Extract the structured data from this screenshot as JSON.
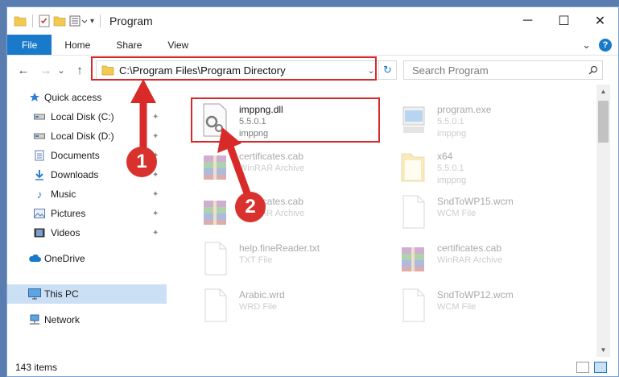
{
  "window": {
    "title": "Program",
    "controls": {
      "minimize": "─",
      "maximize": "☐",
      "close": "✕"
    }
  },
  "ribbon": {
    "tabs": [
      {
        "label": "File"
      },
      {
        "label": "Home"
      },
      {
        "label": "Share"
      },
      {
        "label": "View"
      }
    ],
    "expand_glyph": "⌄",
    "help_glyph": "?"
  },
  "nav": {
    "back_glyph": "←",
    "forward_glyph": "→",
    "recent_glyph": "⌄",
    "up_glyph": "↑",
    "address": "C:\\Program Files\\Program Directory",
    "address_dropdown": "⌄",
    "refresh_glyph": "↻",
    "search_placeholder": "Search Program"
  },
  "sidebar": {
    "items": [
      {
        "label": "Quick access",
        "icon": "star-icon",
        "pinned": false
      },
      {
        "label": "Local Disk (C:)",
        "icon": "drive-icon",
        "pinned": true
      },
      {
        "label": "Local Disk (D:)",
        "icon": "drive-icon",
        "pinned": true
      },
      {
        "label": "Documents",
        "icon": "documents-icon",
        "pinned": true
      },
      {
        "label": "Downloads",
        "icon": "download-icon",
        "pinned": true
      },
      {
        "label": "Music",
        "icon": "music-icon",
        "pinned": true
      },
      {
        "label": "Pictures",
        "icon": "pictures-icon",
        "pinned": true
      },
      {
        "label": "Videos",
        "icon": "videos-icon",
        "pinned": true
      },
      {
        "label": "OneDrive",
        "icon": "cloud-icon",
        "pinned": false
      },
      {
        "label": "This PC",
        "icon": "computer-icon",
        "pinned": false,
        "selected": true
      },
      {
        "label": "Network",
        "icon": "network-icon",
        "pinned": false
      }
    ],
    "pin_glyph": "📌"
  },
  "files": [
    {
      "name": "imppng.dll",
      "line2": "5.5.0.1",
      "line3": "imppng",
      "icon": "dll-icon",
      "highlighted": true
    },
    {
      "name": "program.exe",
      "line2": "5.5.0.1",
      "line3": "imppng",
      "icon": "exe-icon"
    },
    {
      "name": "certificates.cab",
      "line2": "WinRAR Archive",
      "line3": "",
      "icon": "winrar-icon"
    },
    {
      "name": "x64",
      "line2": "5.5.0.1",
      "line3": "imppng",
      "icon": "folder-icon"
    },
    {
      "name": "certificates.cab",
      "line2": "WinRAR Archive",
      "line3": "",
      "icon": "winrar-icon"
    },
    {
      "name": "SndToWP15.wcm",
      "line2": "WCM File",
      "line3": "",
      "icon": "file-icon"
    },
    {
      "name": "help.fineReader.txt",
      "line2": "TXT File",
      "line3": "",
      "icon": "file-icon"
    },
    {
      "name": "certificates.cab",
      "line2": "WinRAR Archive",
      "line3": "",
      "icon": "winrar-icon"
    },
    {
      "name": "Arabic.wrd",
      "line2": "WRD File",
      "line3": "",
      "icon": "file-icon"
    },
    {
      "name": "SndToWP12.wcm",
      "line2": "WCM File",
      "line3": "",
      "icon": "file-icon"
    }
  ],
  "status": {
    "item_count": "143 items"
  },
  "annotations": {
    "step1": "1",
    "step2": "2",
    "accent": "#d92a2a"
  },
  "colors": {
    "accent": "#1979ca",
    "selection": "#cce0f5"
  }
}
